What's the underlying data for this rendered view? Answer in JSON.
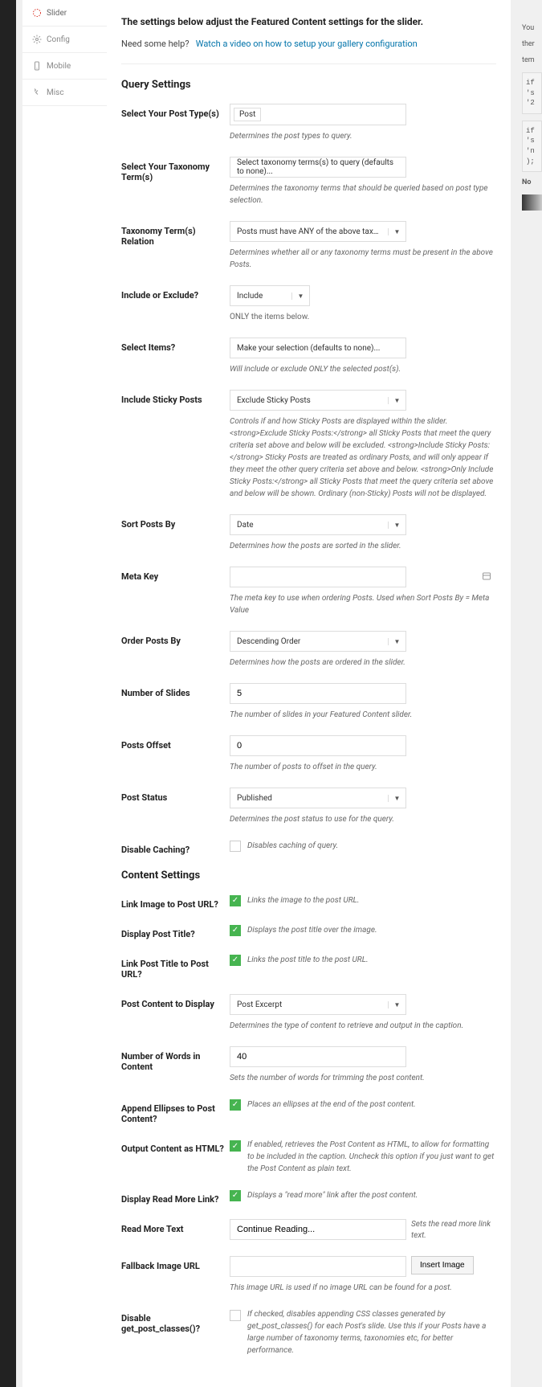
{
  "nav": {
    "items": [
      {
        "label": "Slider"
      },
      {
        "label": "Config"
      },
      {
        "label": "Mobile"
      },
      {
        "label": "Misc"
      }
    ]
  },
  "header": {
    "title": "The settings below adjust the Featured Content settings for the slider.",
    "help_prefix": "Need some help?",
    "help_link": "Watch a video on how to setup your gallery configuration"
  },
  "sections": {
    "query": "Query Settings",
    "content": "Content Settings"
  },
  "query": {
    "post_type": {
      "label": "Select Your Post Type(s)",
      "value": "Post",
      "desc": "Determines the post types to query."
    },
    "taxonomy_terms": {
      "label": "Select Your Taxonomy Term(s)",
      "value": "Select taxonomy terms(s) to query (defaults to none)...",
      "desc": "Determines the taxonomy terms that should be queried based on post type selection."
    },
    "relation": {
      "label": "Taxonomy Term(s) Relation",
      "value": "Posts must have ANY of the above taxono...",
      "desc": "Determines whether all or any taxonomy terms must be present in the above Posts."
    },
    "include_exclude": {
      "label": "Include or Exclude?",
      "value": "Include",
      "desc": "ONLY the items below."
    },
    "select_items": {
      "label": "Select Items?",
      "value": "Make your selection (defaults to none)...",
      "desc": "Will include or exclude ONLY the selected post(s)."
    },
    "sticky": {
      "label": "Include Sticky Posts",
      "value": "Exclude Sticky Posts",
      "desc": "Controls if and how Sticky Posts are displayed within the slider. <strong>Exclude Sticky Posts:</strong> all Sticky Posts that meet the query criteria set above and below will be excluded. <strong>Include Sticky Posts:</strong> Sticky Posts are treated as ordinary Posts, and will only appear if they meet the other query criteria set above and below. <strong>Only Include Sticky Posts:</strong> all Sticky Posts that meet the query criteria set above and below will be shown. Ordinary (non-Sticky) Posts will not be displayed."
    },
    "sort": {
      "label": "Sort Posts By",
      "value": "Date",
      "desc": "Determines how the posts are sorted in the slider."
    },
    "meta_key": {
      "label": "Meta Key",
      "value": "",
      "desc": "The meta key to use when ordering Posts. Used when Sort Posts By = Meta Value"
    },
    "order": {
      "label": "Order Posts By",
      "value": "Descending Order",
      "desc": "Determines how the posts are ordered in the slider."
    },
    "num_slides": {
      "label": "Number of Slides",
      "value": "5",
      "desc": "The number of slides in your Featured Content slider."
    },
    "offset": {
      "label": "Posts Offset",
      "value": "0",
      "desc": "The number of posts to offset in the query."
    },
    "status": {
      "label": "Post Status",
      "value": "Published",
      "desc": "Determines the post status to use for the query."
    },
    "disable_caching": {
      "label": "Disable Caching?",
      "desc": "Disables caching of query."
    }
  },
  "content_sec": {
    "link_image": {
      "label": "Link Image to Post URL?",
      "desc": "Links the image to the post URL."
    },
    "display_title": {
      "label": "Display Post Title?",
      "desc": "Displays the post title over the image."
    },
    "link_title": {
      "label": "Link Post Title to Post URL?",
      "desc": "Links the post title to the post URL."
    },
    "post_content": {
      "label": "Post Content to Display",
      "value": "Post Excerpt",
      "desc": "Determines the type of content to retrieve and output in the caption."
    },
    "num_words": {
      "label": "Number of Words in Content",
      "value": "40",
      "desc": "Sets the number of words for trimming the post content."
    },
    "ellipses": {
      "label": "Append Ellipses to Post Content?",
      "desc": "Places an ellipses at the end of the post content."
    },
    "html": {
      "label": "Output Content as HTML?",
      "desc": "If enabled, retrieves the Post Content as HTML, to allow for formatting to be included in the caption. Uncheck this option if you just want to get the Post Content as plain text."
    },
    "read_more_link": {
      "label": "Display Read More Link?",
      "desc": "Displays a \"read more\" link after the post content."
    },
    "read_more_text": {
      "label": "Read More Text",
      "value": "Continue Reading...",
      "desc": "Sets the read more link text."
    },
    "fallback": {
      "label": "Fallback Image URL",
      "btn": "Insert Image",
      "desc": "This image URL is used if no image URL can be found for a post."
    },
    "disable_classes": {
      "label": "Disable get_post_classes()?",
      "desc": "If checked, disables appending CSS classes generated by get_post_classes() for each Post's slide. Use this if your Posts have a large number of taxonomy terms, taxonomies etc, for better performance."
    }
  },
  "rightcol": {
    "p1": "You",
    "p2": "ther",
    "p3": "tem",
    "code1a": "if",
    "code1b": "'s",
    "code1c": "'2",
    "code2a": "if",
    "code2b": "'s",
    "code2c": "'n",
    "code2d": ");",
    "n": "No"
  }
}
